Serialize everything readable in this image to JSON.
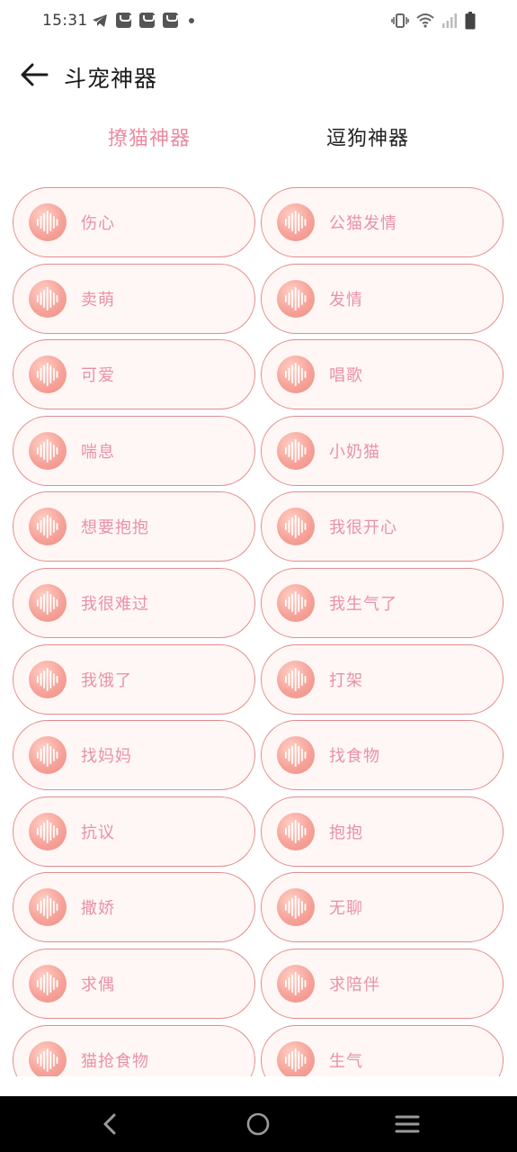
{
  "status_bar": {
    "time": "15:31",
    "left_icons": [
      "telegram-icon",
      "notification-icon",
      "notification-icon",
      "notification-icon",
      "dot-icon"
    ],
    "right_icons": [
      "vibrate-icon",
      "wifi-icon",
      "signal-icon",
      "battery-icon"
    ]
  },
  "header": {
    "title": "斗宠神器",
    "back_icon": "arrow-left-icon"
  },
  "tabs": [
    {
      "label": "撩猫神器",
      "active": true
    },
    {
      "label": "逗狗神器",
      "active": false
    }
  ],
  "sounds": [
    {
      "label": "伤心"
    },
    {
      "label": "公猫发情"
    },
    {
      "label": "卖萌"
    },
    {
      "label": "发情"
    },
    {
      "label": "可爱"
    },
    {
      "label": "唱歌"
    },
    {
      "label": "喘息"
    },
    {
      "label": "小奶猫"
    },
    {
      "label": "想要抱抱"
    },
    {
      "label": "我很开心"
    },
    {
      "label": "我很难过"
    },
    {
      "label": "我生气了"
    },
    {
      "label": "我饿了"
    },
    {
      "label": "打架"
    },
    {
      "label": "找妈妈"
    },
    {
      "label": "找食物"
    },
    {
      "label": "抗议"
    },
    {
      "label": "抱抱"
    },
    {
      "label": "撒娇"
    },
    {
      "label": "无聊"
    },
    {
      "label": "求偶"
    },
    {
      "label": "求陪伴"
    },
    {
      "label": "猫抢食物"
    },
    {
      "label": "生气"
    }
  ],
  "sound_icon": "sound-wave-icon",
  "colors": {
    "accent": "#ec8ba0",
    "pill_border": "#e38b8d",
    "pill_background": "#fff7f5",
    "label_text": "#e891a8"
  },
  "nav_bar": {
    "icons": [
      "back-icon",
      "home-icon",
      "recents-icon"
    ]
  }
}
